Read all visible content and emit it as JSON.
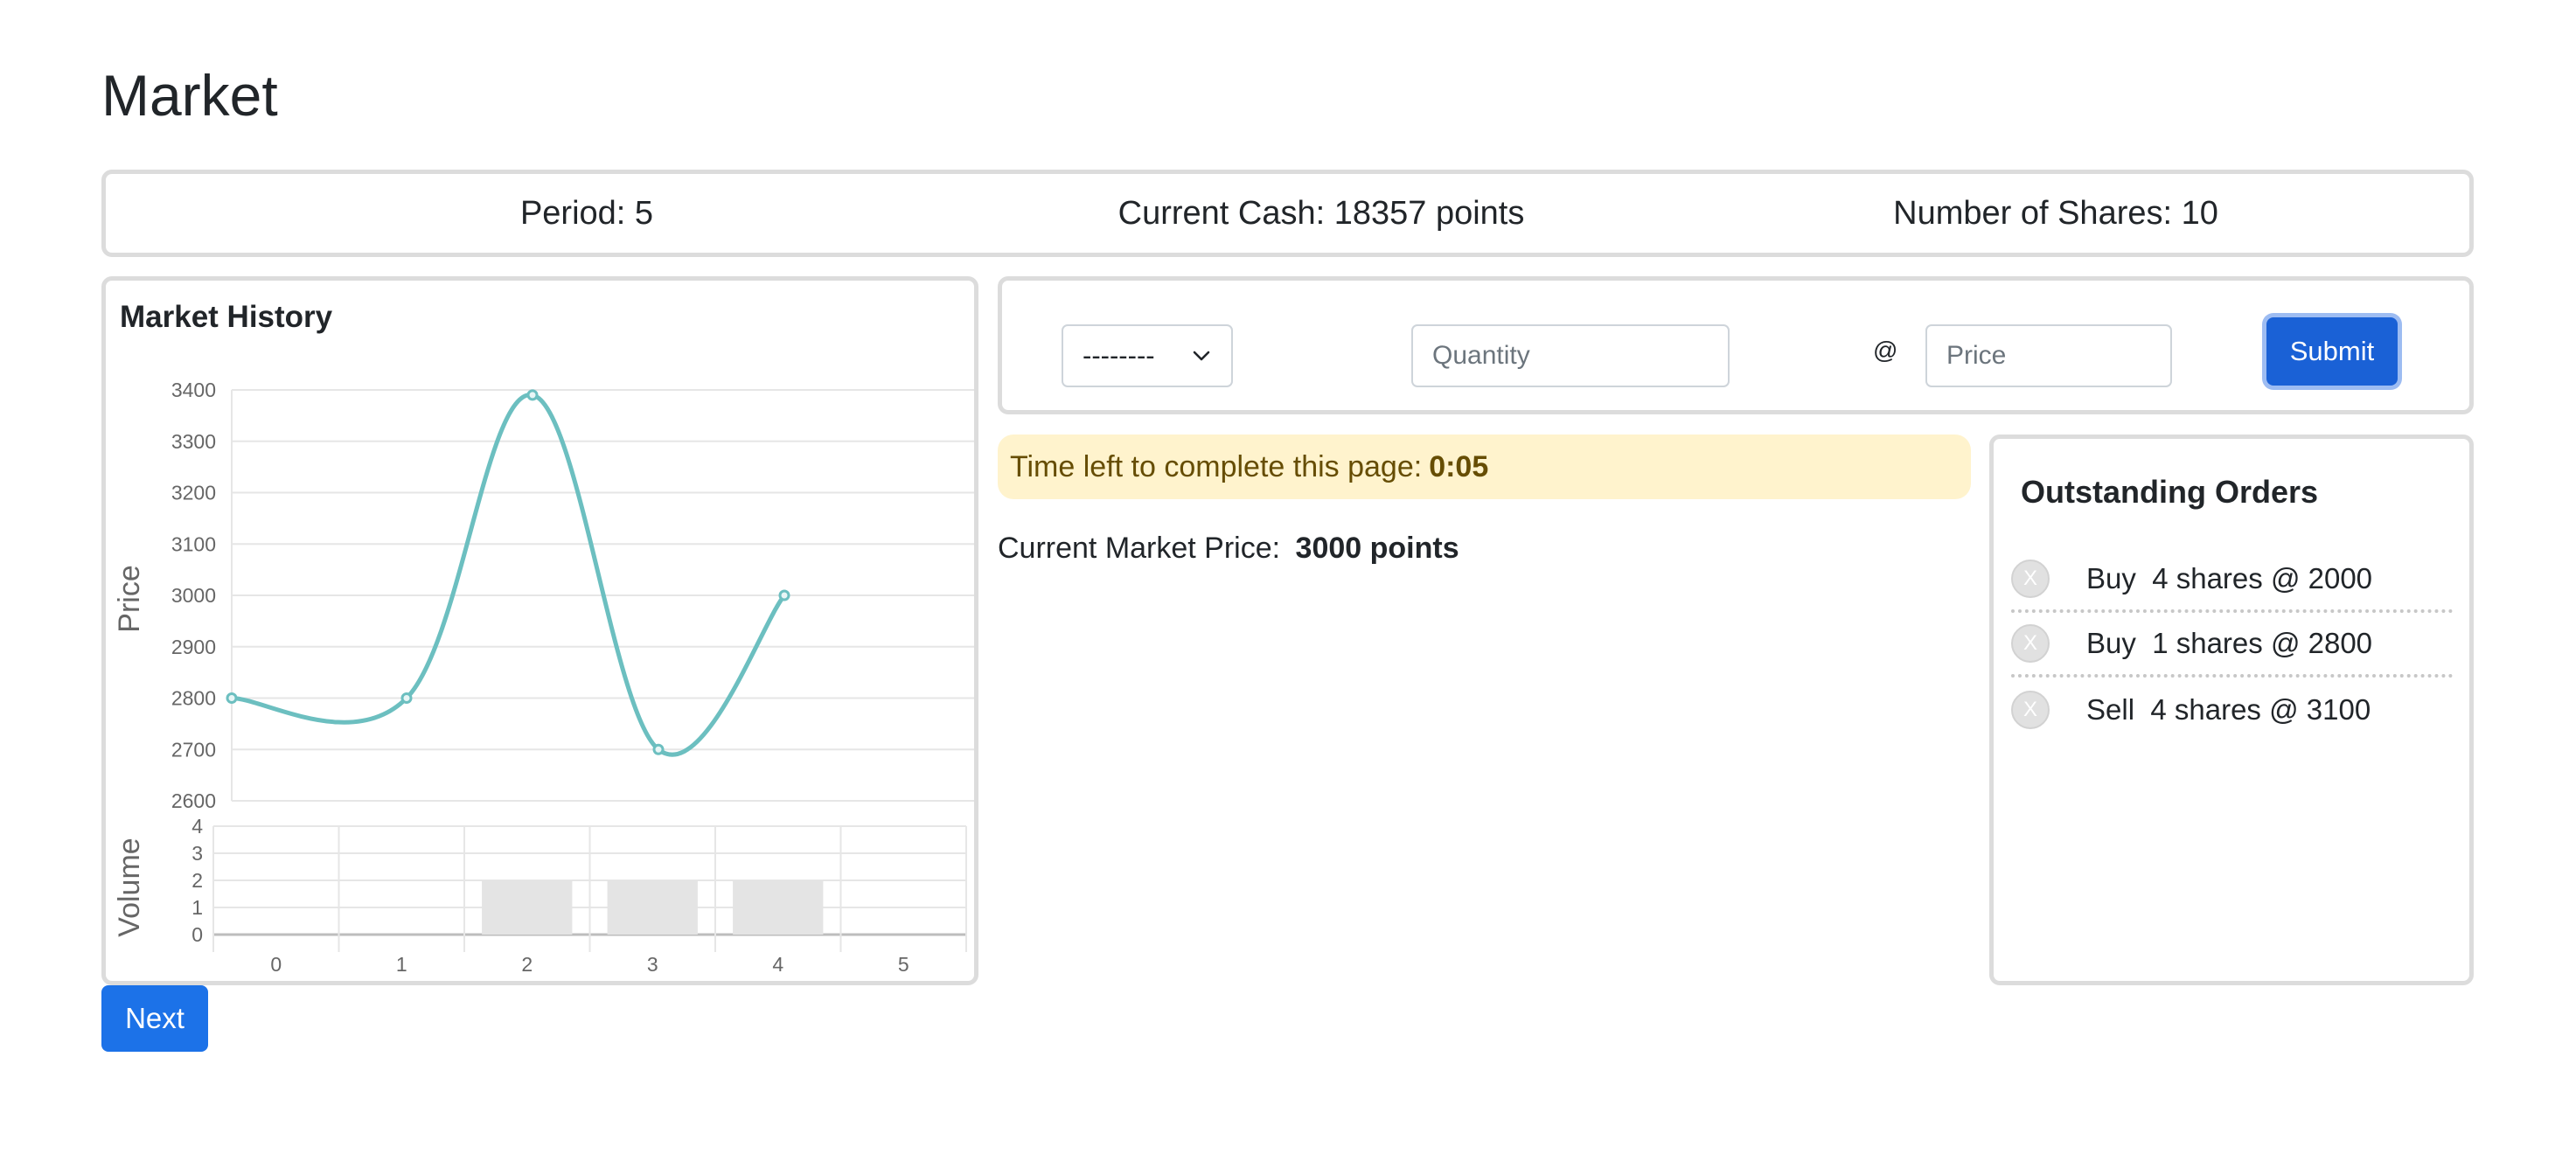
{
  "page": {
    "title": "Market"
  },
  "stats": {
    "period": "Period: 5",
    "cash": "Current Cash: 18357 points",
    "shares": "Number of Shares: 10"
  },
  "history": {
    "title": "Market History"
  },
  "order_form": {
    "type_value": "--------",
    "quantity_placeholder": "Quantity",
    "at_symbol": "@",
    "price_placeholder": "Price",
    "submit_label": "Submit"
  },
  "timer": {
    "label": "Time left to complete this page:",
    "value": "0:05"
  },
  "market_price": {
    "label": "Current Market Price:",
    "value": "3000 points"
  },
  "orders": {
    "title": "Outstanding Orders",
    "cancel_glyph": "X",
    "items": [
      {
        "text": "Buy  4 shares @ 2000"
      },
      {
        "text": "Buy  1 shares @ 2800"
      },
      {
        "text": "Sell  4 shares @ 3100"
      }
    ]
  },
  "next_label": "Next",
  "colors": {
    "line": "#6cbfc0",
    "volume_bar": "#e4e4e4",
    "primary": "#1a61d6",
    "warning_bg": "#fff3cd"
  },
  "chart_data": [
    {
      "type": "line",
      "ylabel": "Price",
      "x": [
        0,
        1,
        2,
        3,
        4
      ],
      "series": [
        {
          "values": [
            2800,
            2800,
            3390,
            2700,
            3000
          ]
        }
      ],
      "ylim": [
        2600,
        3400
      ],
      "yticks": [
        "3400",
        "3300",
        "3200",
        "3100",
        "3000",
        "2900",
        "2800",
        "2700",
        "2600"
      ],
      "grid": true
    },
    {
      "type": "bar",
      "ylabel": "Volume",
      "categories": [
        "0",
        "1",
        "2",
        "3",
        "4",
        "5"
      ],
      "values": [
        0,
        0,
        2,
        2,
        2,
        0
      ],
      "ylim": [
        0,
        4
      ],
      "yticks": [
        "4",
        "3",
        "2",
        "1",
        "0"
      ],
      "grid": true
    }
  ]
}
